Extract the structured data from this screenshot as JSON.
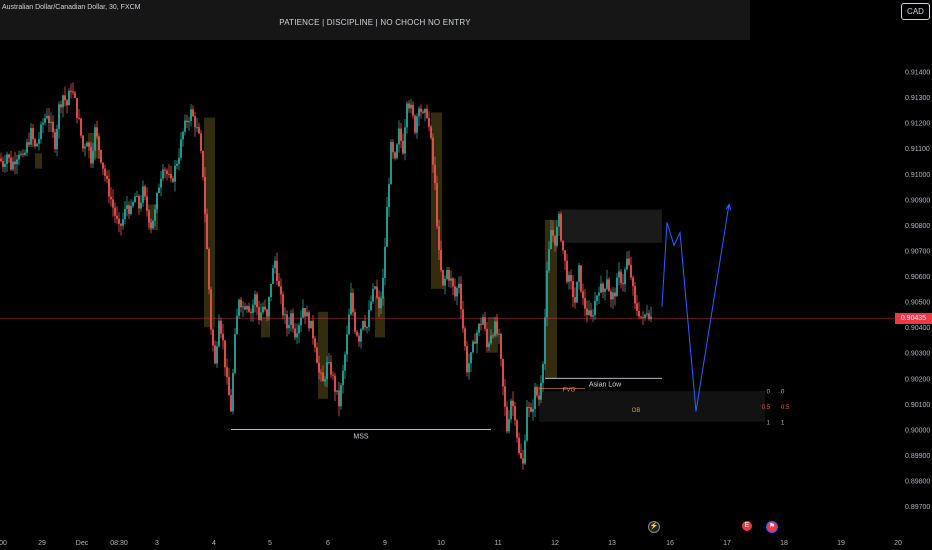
{
  "symbol": {
    "title": "Australian Dollar/Canadian Dollar, 30, FXCM"
  },
  "banner": {
    "text": "PATIENCE  |  DISCIPLINE  |  NO CHOCH NO ENTRY"
  },
  "currency": "CAD",
  "last_price_label": "0.90435",
  "colors": {
    "background": "#000000",
    "up": "#26a69a",
    "down": "#ef5350",
    "zone": "#3d3410",
    "projection": "#2962ff",
    "price_line": "#f23645"
  },
  "events": [
    {
      "name": "lightning-icon",
      "glyph": "⚡"
    },
    {
      "name": "calendar-event-icon",
      "glyph": "E"
    },
    {
      "name": "flag-event-icon",
      "glyph": "⚑"
    }
  ],
  "chart_data": {
    "type": "candlestick",
    "ylim": [
      0.8963,
      0.915
    ],
    "y_ticks": [
      "0.91400",
      "0.91300",
      "0.91200",
      "0.91100",
      "0.91000",
      "0.90900",
      "0.90800",
      "0.90700",
      "0.90600",
      "0.90500",
      "0.90400",
      "0.90300",
      "0.90200",
      "0.90100",
      "0.90000",
      "0.89900",
      "0.89800",
      "0.89700"
    ],
    "x_ticks": [
      "00",
      "29",
      "Dec",
      "08:30",
      "3",
      "4",
      "5",
      "6",
      "9",
      "10",
      "11",
      "12",
      "13",
      "16",
      "17",
      "18",
      "19",
      "20"
    ],
    "last_price": 0.90435,
    "path": [
      [
        0,
        0.9106
      ],
      [
        4,
        0.9104
      ],
      [
        8,
        0.9108
      ],
      [
        12,
        0.9103
      ],
      [
        16,
        0.9106
      ],
      [
        20,
        0.9109
      ],
      [
        24,
        0.9105
      ],
      [
        28,
        0.9111
      ],
      [
        32,
        0.9116
      ],
      [
        36,
        0.911
      ],
      [
        40,
        0.9114
      ],
      [
        44,
        0.912
      ],
      [
        48,
        0.9124
      ],
      [
        52,
        0.9118
      ],
      [
        56,
        0.9112
      ],
      [
        60,
        0.9126
      ],
      [
        64,
        0.9131
      ],
      [
        68,
        0.9127
      ],
      [
        72,
        0.9134
      ],
      [
        76,
        0.9128
      ],
      [
        80,
        0.912
      ],
      [
        84,
        0.911
      ],
      [
        88,
        0.9114
      ],
      [
        92,
        0.9106
      ],
      [
        96,
        0.9117
      ],
      [
        100,
        0.911
      ],
      [
        104,
        0.9103
      ],
      [
        108,
        0.9096
      ],
      [
        112,
        0.909
      ],
      [
        116,
        0.9084
      ],
      [
        120,
        0.9078
      ],
      [
        124,
        0.9082
      ],
      [
        128,
        0.9088
      ],
      [
        132,
        0.9085
      ],
      [
        136,
        0.9091
      ],
      [
        140,
        0.9087
      ],
      [
        144,
        0.9093
      ],
      [
        148,
        0.9086
      ],
      [
        152,
        0.908
      ],
      [
        156,
        0.9085
      ],
      [
        160,
        0.9096
      ],
      [
        164,
        0.9104
      ],
      [
        168,
        0.91
      ],
      [
        172,
        0.9096
      ],
      [
        176,
        0.9102
      ],
      [
        180,
        0.9108
      ],
      [
        184,
        0.9116
      ],
      [
        188,
        0.9121
      ],
      [
        192,
        0.9124
      ],
      [
        196,
        0.912
      ],
      [
        200,
        0.9114
      ],
      [
        204,
        0.91
      ],
      [
        208,
        0.907
      ],
      [
        212,
        0.904
      ],
      [
        216,
        0.9025
      ],
      [
        220,
        0.9045
      ],
      [
        224,
        0.9034
      ],
      [
        228,
        0.9018
      ],
      [
        232,
        0.9008
      ],
      [
        236,
        0.9035
      ],
      [
        240,
        0.9052
      ],
      [
        244,
        0.9048
      ],
      [
        248,
        0.905
      ],
      [
        252,
        0.9046
      ],
      [
        256,
        0.9052
      ],
      [
        260,
        0.9044
      ],
      [
        264,
        0.9048
      ],
      [
        268,
        0.9043
      ],
      [
        272,
        0.9058
      ],
      [
        276,
        0.9066
      ],
      [
        280,
        0.9055
      ],
      [
        284,
        0.9046
      ],
      [
        288,
        0.904
      ],
      [
        292,
        0.9045
      ],
      [
        296,
        0.9038
      ],
      [
        300,
        0.9042
      ],
      [
        304,
        0.9048
      ],
      [
        308,
        0.9044
      ],
      [
        312,
        0.904
      ],
      [
        316,
        0.9034
      ],
      [
        320,
        0.9022
      ],
      [
        324,
        0.9018
      ],
      [
        328,
        0.9025
      ],
      [
        332,
        0.9023
      ],
      [
        336,
        0.9016
      ],
      [
        340,
        0.901
      ],
      [
        344,
        0.9022
      ],
      [
        348,
        0.9036
      ],
      [
        352,
        0.9052
      ],
      [
        356,
        0.904
      ],
      [
        360,
        0.9036
      ],
      [
        364,
        0.9044
      ],
      [
        368,
        0.904
      ],
      [
        372,
        0.905
      ],
      [
        376,
        0.9056
      ],
      [
        380,
        0.9046
      ],
      [
        384,
        0.9058
      ],
      [
        388,
        0.9086
      ],
      [
        392,
        0.911
      ],
      [
        396,
        0.9104
      ],
      [
        400,
        0.9116
      ],
      [
        404,
        0.911
      ],
      [
        408,
        0.913
      ],
      [
        412,
        0.9125
      ],
      [
        416,
        0.9118
      ],
      [
        420,
        0.9128
      ],
      [
        424,
        0.9122
      ],
      [
        428,
        0.9124
      ],
      [
        432,
        0.9112
      ],
      [
        436,
        0.9095
      ],
      [
        440,
        0.9068
      ],
      [
        444,
        0.9055
      ],
      [
        448,
        0.9062
      ],
      [
        452,
        0.9058
      ],
      [
        456,
        0.9052
      ],
      [
        460,
        0.9058
      ],
      [
        464,
        0.904
      ],
      [
        468,
        0.9024
      ],
      [
        472,
        0.9028
      ],
      [
        476,
        0.9036
      ],
      [
        480,
        0.904
      ],
      [
        484,
        0.9044
      ],
      [
        488,
        0.9032
      ],
      [
        492,
        0.9038
      ],
      [
        496,
        0.904
      ],
      [
        500,
        0.9035
      ],
      [
        504,
        0.9016
      ],
      [
        508,
        0.9
      ],
      [
        512,
        0.9012
      ],
      [
        516,
        0.9006
      ],
      [
        520,
        0.899
      ],
      [
        524,
        0.8986
      ],
      [
        528,
        0.901
      ],
      [
        532,
        0.9005
      ],
      [
        536,
        0.9015
      ],
      [
        540,
        0.9012
      ],
      [
        544,
        0.9028
      ],
      [
        548,
        0.906
      ],
      [
        552,
        0.9078
      ],
      [
        556,
        0.9074
      ],
      [
        560,
        0.9082
      ],
      [
        564,
        0.907
      ],
      [
        568,
        0.906
      ],
      [
        572,
        0.9056
      ],
      [
        576,
        0.905
      ],
      [
        580,
        0.9062
      ],
      [
        584,
        0.905
      ],
      [
        588,
        0.9046
      ],
      [
        592,
        0.9043
      ],
      [
        596,
        0.905
      ],
      [
        600,
        0.9056
      ],
      [
        604,
        0.9054
      ],
      [
        608,
        0.906
      ],
      [
        612,
        0.905
      ],
      [
        616,
        0.9054
      ],
      [
        620,
        0.906
      ],
      [
        624,
        0.9058
      ],
      [
        628,
        0.9066
      ],
      [
        632,
        0.906
      ],
      [
        636,
        0.9048
      ],
      [
        640,
        0.9046
      ],
      [
        644,
        0.9042
      ],
      [
        648,
        0.9047
      ],
      [
        652,
        0.9044
      ]
    ],
    "zones": [
      {
        "x0": 35,
        "x1": 42,
        "y0": 0.9102,
        "y1": 0.9108
      },
      {
        "x0": 88,
        "x1": 100,
        "y0": 0.9106,
        "y1": 0.9116
      },
      {
        "x0": 148,
        "x1": 158,
        "y0": 0.9078,
        "y1": 0.9088
      },
      {
        "x0": 204,
        "x1": 215,
        "y0": 0.904,
        "y1": 0.9122
      },
      {
        "x0": 261,
        "x1": 270,
        "y0": 0.9036,
        "y1": 0.9044
      },
      {
        "x0": 318,
        "x1": 328,
        "y0": 0.9012,
        "y1": 0.9046
      },
      {
        "x0": 375,
        "x1": 385,
        "y0": 0.9036,
        "y1": 0.9052
      },
      {
        "x0": 431,
        "x1": 442,
        "y0": 0.9055,
        "y1": 0.9124
      },
      {
        "x0": 488,
        "x1": 498,
        "y0": 0.903,
        "y1": 0.9044
      },
      {
        "x0": 545,
        "x1": 557,
        "y0": 0.902,
        "y1": 0.9082
      }
    ],
    "supply_box": {
      "x0": 560,
      "x1": 662,
      "y0": 0.9073,
      "y1": 0.9086
    },
    "ob_box": {
      "x0": 539,
      "x1": 765,
      "y0": 0.9003,
      "y1": 0.9015
    },
    "fvg": {
      "x0": 539,
      "x1": 585,
      "y": 0.9016
    },
    "asian_low": {
      "x0": 545,
      "x1": 662,
      "y": 0.902
    },
    "mss": {
      "x0": 231,
      "x1": 491,
      "y": 0.9
    },
    "projection": [
      [
        662,
        0.9048
      ],
      [
        667,
        0.9081
      ],
      [
        674,
        0.9072
      ],
      [
        680,
        0.9077
      ],
      [
        696,
        0.9007
      ],
      [
        729,
        0.9088
      ]
    ],
    "fib_levels": [
      {
        "left": "0",
        "right": "0",
        "y": 0.9015
      },
      {
        "left": "0.5",
        "right": "0.5",
        "y": 0.9009
      },
      {
        "left": "1",
        "right": "1",
        "y": 0.9003
      }
    ],
    "labels": {
      "mss": "MSS",
      "asian_low": "Asian Low",
      "fvg": "FVG",
      "ob": "OB"
    }
  }
}
